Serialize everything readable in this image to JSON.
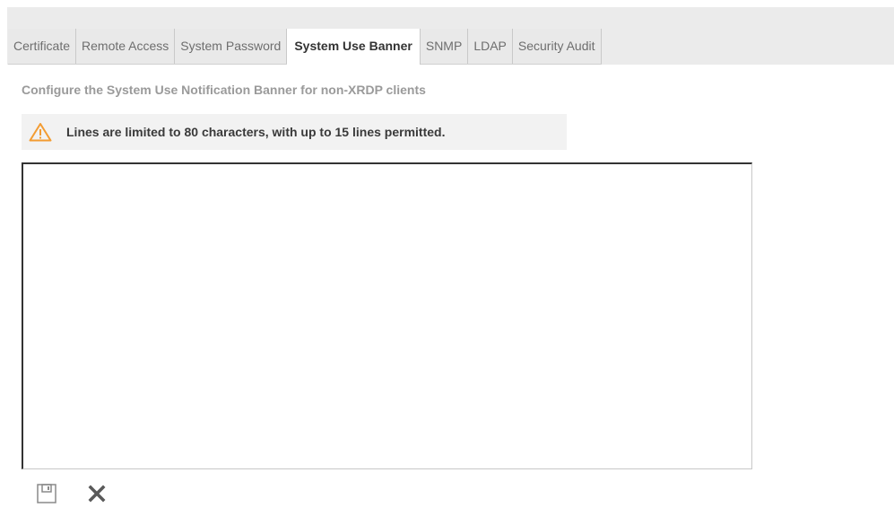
{
  "tabs": [
    {
      "label": "Certificate",
      "active": false
    },
    {
      "label": "Remote Access",
      "active": false
    },
    {
      "label": "System Password",
      "active": false
    },
    {
      "label": "System Use Banner",
      "active": true
    },
    {
      "label": "SNMP",
      "active": false
    },
    {
      "label": "LDAP",
      "active": false
    },
    {
      "label": "Security Audit",
      "active": false
    }
  ],
  "main": {
    "description": "Configure the System Use Notification Banner for non-XRDP clients",
    "warning": {
      "icon": "warning-triangle-icon",
      "text": "Lines are limited to 80 characters, with up to 15 lines permitted.",
      "color": "#f39c32"
    },
    "banner_text": ""
  },
  "actions": {
    "save_icon": "save-icon",
    "cancel_icon": "close-icon"
  }
}
